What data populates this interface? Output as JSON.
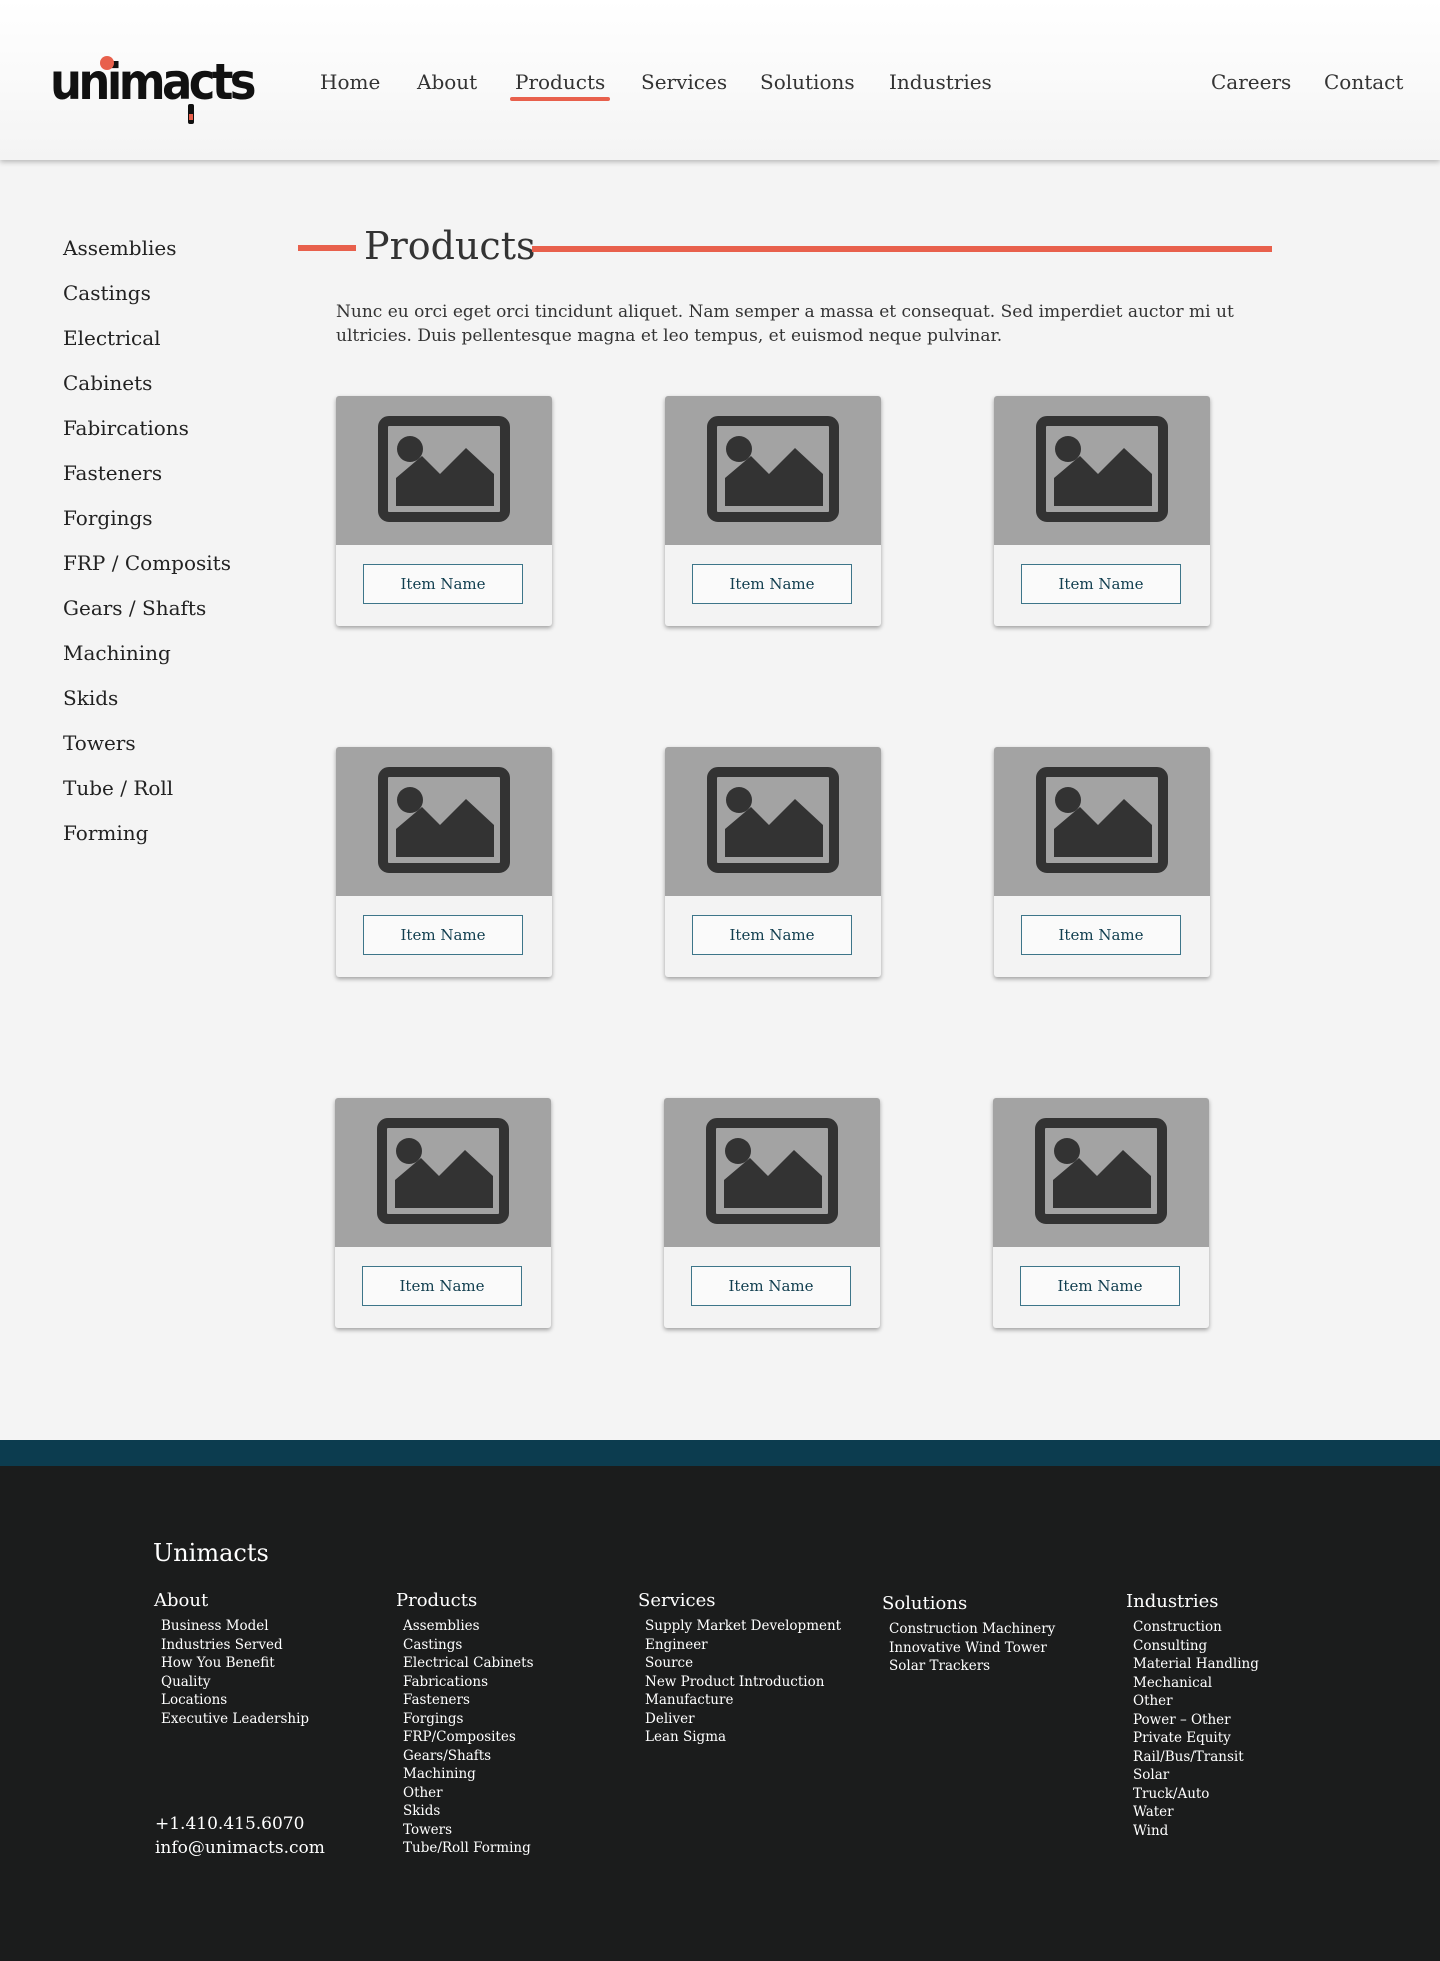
{
  "brand": {
    "logo_text": "unimacts",
    "accent_color": "#e8604c",
    "footer_band_color": "#0c3c4f"
  },
  "nav": {
    "items": [
      {
        "label": "Home"
      },
      {
        "label": "About"
      },
      {
        "label": "Products",
        "active": true
      },
      {
        "label": "Services"
      },
      {
        "label": "Solutions"
      },
      {
        "label": "Industries"
      },
      {
        "label": "Careers"
      },
      {
        "label": "Contact"
      }
    ]
  },
  "sidebar": {
    "items": [
      "Assemblies",
      "Castings",
      "Electrical",
      "Cabinets",
      "Fabircations",
      "Fasteners",
      "Forgings",
      "FRP / Composits",
      "Gears / Shafts",
      "Machining",
      "Skids",
      "Towers",
      "Tube / Roll",
      "Forming"
    ]
  },
  "main": {
    "title": "Products",
    "intro": "Nunc eu orci eget orci tincidunt aliquet. Nam semper a massa et consequat. Sed imperdiet auctor mi ut ultricies. Duis pellentesque magna et leo tempus, et euismod neque pulvinar.",
    "cards": [
      {
        "label": "Item Name",
        "icon": "image-placeholder-icon"
      },
      {
        "label": "Item Name",
        "icon": "image-placeholder-icon"
      },
      {
        "label": "Item Name",
        "icon": "image-placeholder-icon"
      },
      {
        "label": "Item Name",
        "icon": "image-placeholder-icon"
      },
      {
        "label": "Item Name",
        "icon": "image-placeholder-icon"
      },
      {
        "label": "Item Name",
        "icon": "image-placeholder-icon"
      },
      {
        "label": "Item Name",
        "icon": "image-placeholder-icon"
      },
      {
        "label": "Item Name",
        "icon": "image-placeholder-icon"
      },
      {
        "label": "Item Name",
        "icon": "image-placeholder-icon"
      }
    ]
  },
  "footer": {
    "brand": "Unimacts",
    "columns": [
      {
        "title": "About",
        "items": [
          "Business Model",
          "Industries Served",
          "How You Benefit",
          "Quality",
          "Locations",
          "Executive Leadership"
        ]
      },
      {
        "title": "Products",
        "items": [
          "Assemblies",
          "Castings",
          "Electrical Cabinets",
          "Fabrications",
          "Fasteners",
          "Forgings",
          "FRP/Composites",
          "Gears/Shafts",
          "Machining",
          "Other",
          "Skids",
          "Towers",
          "Tube/Roll Forming"
        ]
      },
      {
        "title": "Services",
        "items": [
          "Supply Market Development",
          "Engineer",
          "Source",
          "New Product Introduction",
          "Manufacture",
          "Deliver",
          "Lean Sigma"
        ]
      },
      {
        "title": "Solutions",
        "items": [
          "Construction Machinery",
          "Innovative Wind Tower",
          "Solar Trackers"
        ]
      },
      {
        "title": "Industries",
        "items": [
          "Construction",
          "Consulting",
          "Material Handling",
          "Mechanical",
          "Other",
          "Power – Other",
          "Private Equity",
          "Rail/Bus/Transit",
          "Solar",
          "Truck/Auto",
          "Water",
          "Wind"
        ]
      }
    ],
    "phone": "+1.410.415.6070",
    "email": "info@unimacts.com"
  }
}
